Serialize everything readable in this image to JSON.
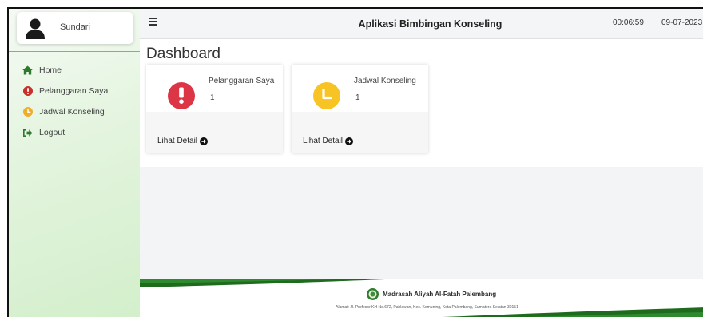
{
  "user": {
    "name": "Sundari",
    "avatar_icon": "user-icon"
  },
  "sidebar": {
    "items": [
      {
        "label": "Home",
        "icon": "home-icon",
        "color": "#2d7a2d"
      },
      {
        "label": "Pelanggaran Saya",
        "icon": "exclamation-circle-icon",
        "color": "#c9302c"
      },
      {
        "label": "Jadwal Konseling",
        "icon": "clock-icon",
        "color": "#f0ad2b"
      },
      {
        "label": "Logout",
        "icon": "sign-out-icon",
        "color": "#2d7a2d"
      }
    ]
  },
  "topbar": {
    "menu_icon": "hamburger-icon",
    "title": "Aplikasi Bimbingan Konseling",
    "time": "00:06:59",
    "date": "09-07-2023"
  },
  "main": {
    "page_title": "Dashboard",
    "cards": [
      {
        "label": "Pelanggaran Saya",
        "value": "1",
        "icon": "exclamation-icon",
        "icon_color": "#dc3545",
        "link": "Lihat Detail"
      },
      {
        "label": "Jadwal Konseling",
        "value": "1",
        "icon": "clock-icon",
        "icon_color": "#f7c325",
        "link": "Lihat Detail"
      }
    ]
  },
  "footer": {
    "school_name": "Madrasah Aliyah Al-Fatah Palembang",
    "address": "Alamat: Jl. Profesor KH No.672, Pahlawan, Kec. Kemuning, Kota Palembang, Sumatera Selatan 30151",
    "accent_color": "#1e6b1e"
  }
}
